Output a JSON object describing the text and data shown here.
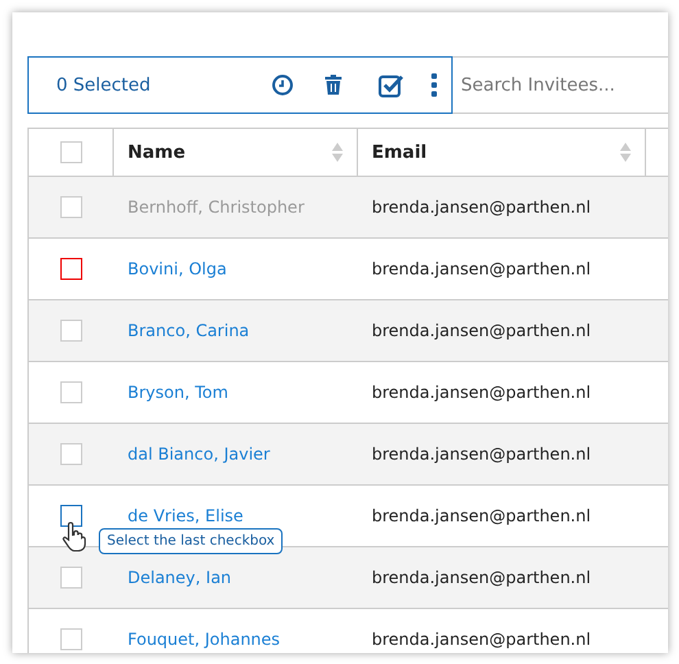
{
  "toolbar": {
    "selected_count": "0 Selected",
    "search": {
      "placeholder": "Search Invitees..."
    }
  },
  "table": {
    "columns": [
      "Name",
      "Email"
    ],
    "select_all": {
      "checked": false
    },
    "rows": [
      {
        "name": "Bernhoff, Christopher",
        "email": "brenda.jansen@parthen.nl",
        "checked": false,
        "disabled": true,
        "flagged": false,
        "hovered": false
      },
      {
        "name": "Bovini, Olga",
        "email": "brenda.jansen@parthen.nl",
        "checked": false,
        "disabled": false,
        "flagged": true,
        "hovered": false
      },
      {
        "name": "Branco, Carina",
        "email": "brenda.jansen@parthen.nl",
        "checked": false,
        "disabled": false,
        "flagged": false,
        "hovered": false
      },
      {
        "name": "Bryson, Tom",
        "email": "brenda.jansen@parthen.nl",
        "checked": false,
        "disabled": false,
        "flagged": false,
        "hovered": false
      },
      {
        "name": "dal Bianco, Javier",
        "email": "brenda.jansen@parthen.nl",
        "checked": false,
        "disabled": false,
        "flagged": false,
        "hovered": false
      },
      {
        "name": "de Vries, Elise",
        "email": "brenda.jansen@parthen.nl",
        "checked": false,
        "disabled": false,
        "flagged": false,
        "hovered": true,
        "tooltip": "Select the last checkbox"
      },
      {
        "name": "Delaney, Ian",
        "email": "brenda.jansen@parthen.nl",
        "checked": false,
        "disabled": false,
        "flagged": false,
        "hovered": false
      },
      {
        "name": "Fouquet, Johannes",
        "email": "brenda.jansen@parthen.nl",
        "checked": false,
        "disabled": false,
        "flagged": false,
        "hovered": false
      }
    ]
  }
}
